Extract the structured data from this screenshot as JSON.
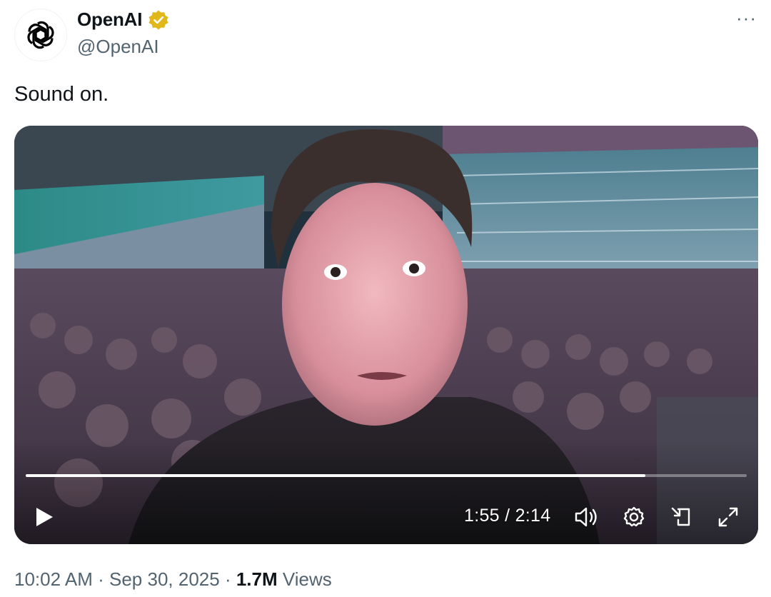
{
  "author": {
    "display_name": "OpenAI",
    "handle": "@OpenAI",
    "avatar_icon": "openai-logo-icon",
    "verified_icon": "verified-badge-icon",
    "verified_color": "#e2b719"
  },
  "more_icon": "more-options-icon",
  "more_label": "···",
  "text": "Sound on.",
  "video": {
    "progress": 0.859,
    "time": "1:55 / 2:14",
    "play_icon": "play-icon",
    "volume_icon": "volume-icon",
    "settings_icon": "settings-gear-icon",
    "pip_icon": "picture-in-picture-icon",
    "fullscreen_icon": "fullscreen-icon"
  },
  "meta": {
    "time": "10:02 AM",
    "separator": "·",
    "date": "Sep 30, 2025",
    "views_count": "1.7M",
    "views_label": "Views"
  },
  "colors": {
    "text_primary": "#0f1419",
    "text_secondary": "#536471"
  }
}
